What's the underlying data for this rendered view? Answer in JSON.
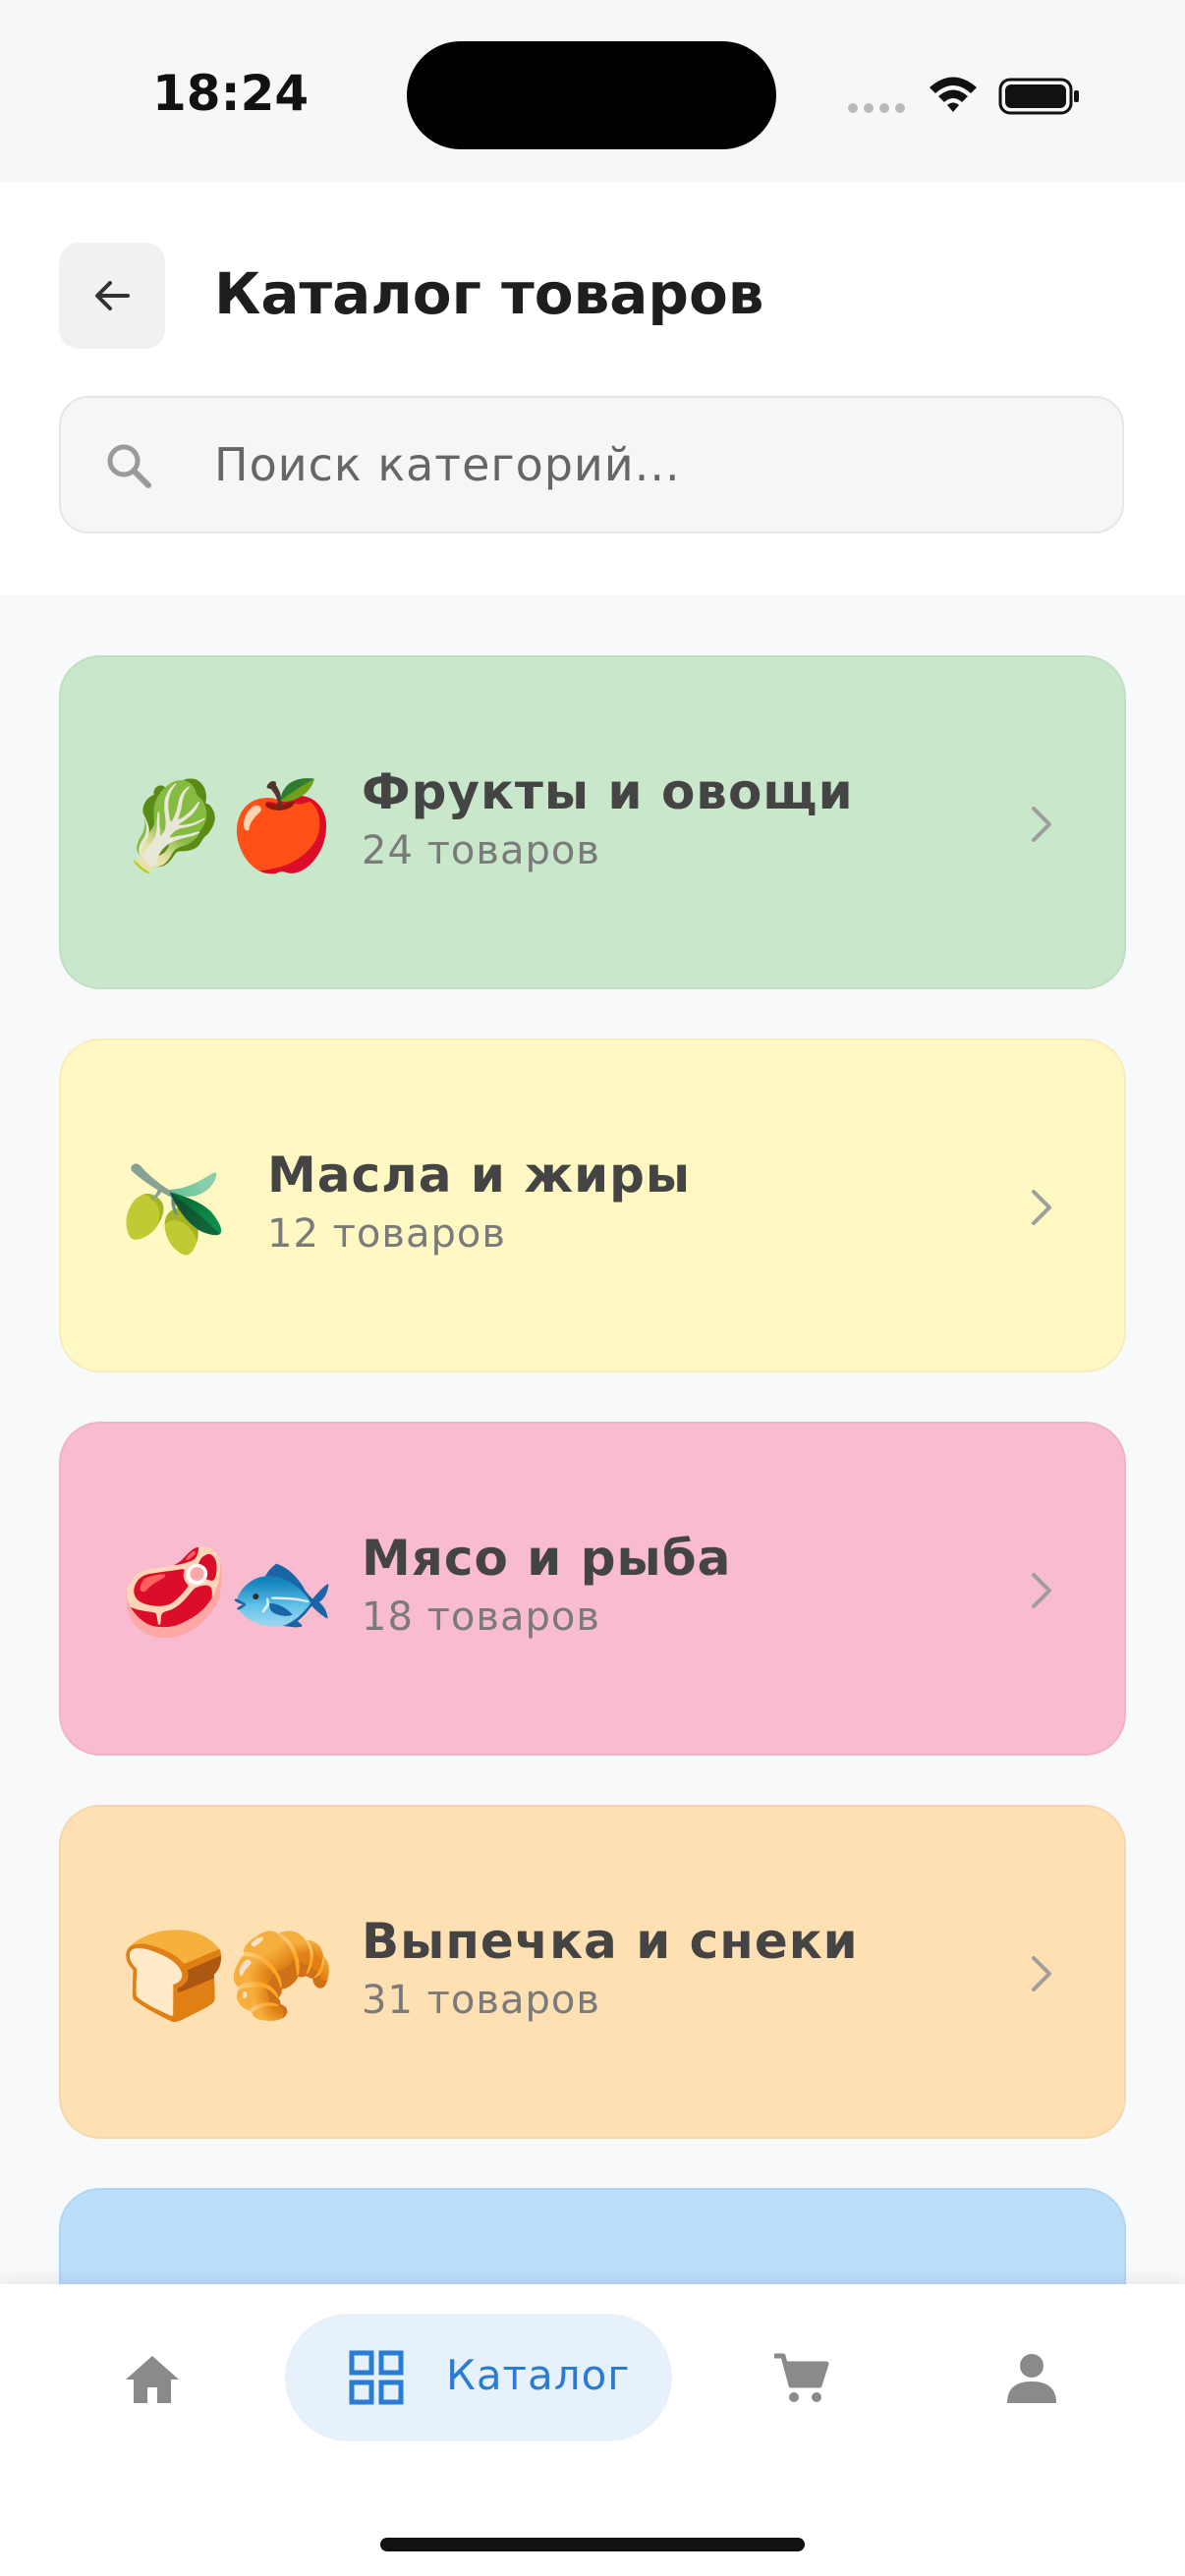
{
  "status_bar": {
    "time": "18:24",
    "icons": [
      "cellular-signal-icon",
      "wifi-icon",
      "battery-icon"
    ]
  },
  "header": {
    "back_icon": "arrow-left-icon",
    "title": "Каталог товаров"
  },
  "search": {
    "icon": "search-icon",
    "placeholder": "Поиск категорий..."
  },
  "categories": [
    {
      "emoji": "🥬🍎",
      "name": "Фрукты и овощи",
      "count": "24 товаров",
      "color": "#c9e7ca"
    },
    {
      "emoji": "🫒",
      "name": "Масла и жиры",
      "count": "12 товаров",
      "color": "#fff8c2"
    },
    {
      "emoji": "🥩🐟",
      "name": "Мясо и рыба",
      "count": "18 товаров",
      "color": "#f8bbd0"
    },
    {
      "emoji": "🍞🥐",
      "name": "Выпечка и снеки",
      "count": "31 товаров",
      "color": "#ffe0b2"
    },
    {
      "emoji": "",
      "name": "",
      "count": "",
      "color": "#bbdefb"
    }
  ],
  "bottom_nav": {
    "active_color": "#2a7bd2",
    "inactive_color": "#8a8a8a",
    "items": [
      {
        "icon": "home-icon",
        "label": ""
      },
      {
        "icon": "grid-icon",
        "label": "Каталог"
      },
      {
        "icon": "cart-icon",
        "label": ""
      },
      {
        "icon": "person-icon",
        "label": ""
      }
    ]
  }
}
